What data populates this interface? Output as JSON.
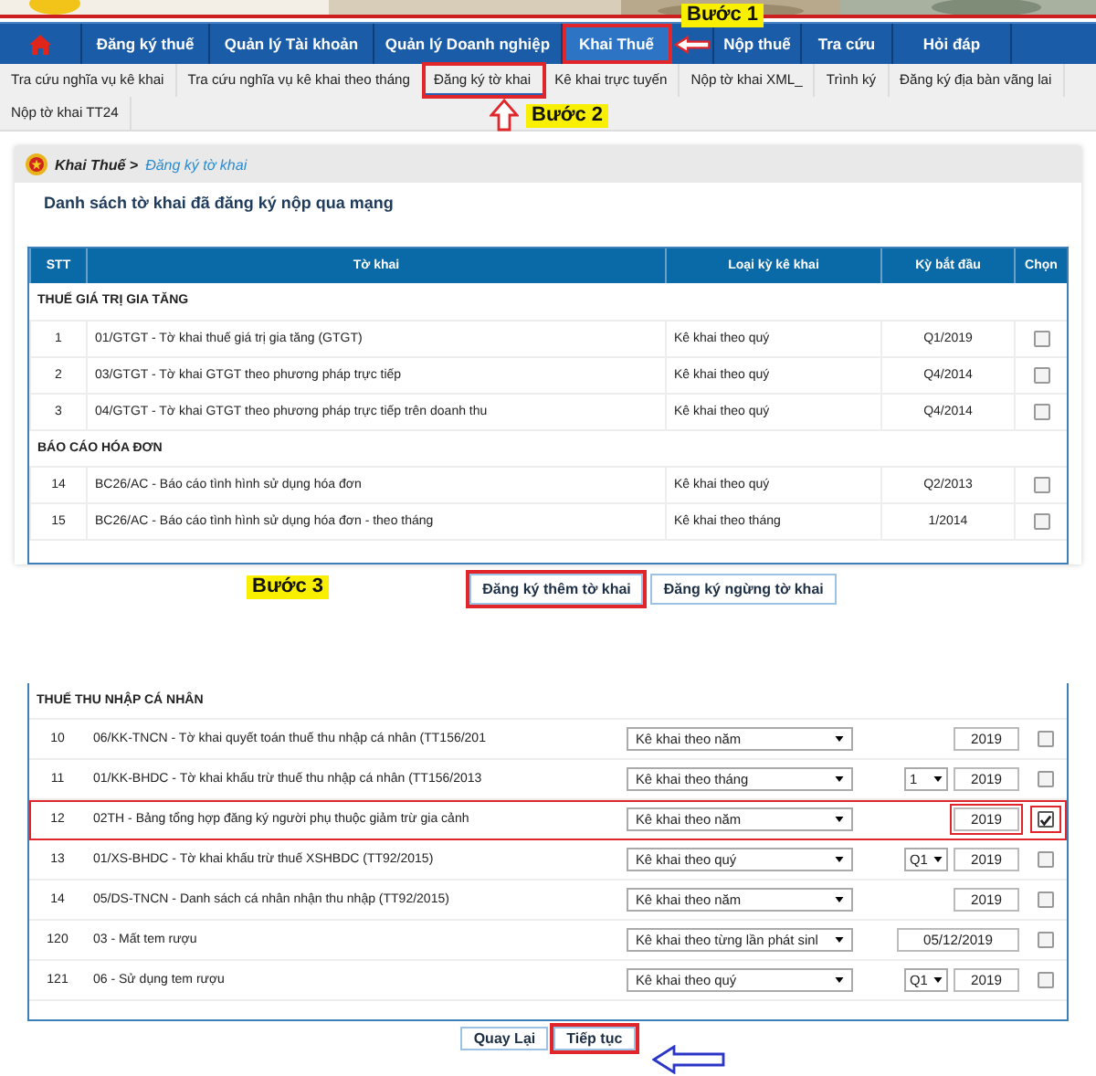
{
  "nav": {
    "items": [
      {
        "kind": "home",
        "selected": false,
        "highlighted": false
      },
      {
        "label": "Đăng ký thuế",
        "selected": false,
        "highlighted": false
      },
      {
        "label": "Quản lý Tài khoản",
        "selected": false,
        "highlighted": false
      },
      {
        "label": "Quản lý Doanh nghiệp",
        "selected": false,
        "highlighted": false
      },
      {
        "label": "Khai Thuế",
        "selected": true,
        "highlighted": true
      },
      {
        "label": "Nộp thuế",
        "selected": false,
        "highlighted": false
      },
      {
        "label": "Tra cứu",
        "selected": false,
        "highlighted": false
      },
      {
        "label": "Hỏi đáp",
        "selected": false,
        "highlighted": false
      }
    ]
  },
  "subnav": {
    "items": [
      {
        "label": "Tra cứu nghĩa vụ kê khai",
        "selected": false,
        "highlighted": false
      },
      {
        "label": "Tra cứu nghĩa vụ kê khai theo tháng",
        "selected": false,
        "highlighted": false
      },
      {
        "label": "Đăng ký tờ khai",
        "selected": true,
        "highlighted": true
      },
      {
        "label": "Kê khai trực tuyến",
        "selected": false,
        "highlighted": false
      },
      {
        "label": "Nộp tờ khai XML_",
        "selected": false,
        "highlighted": false
      },
      {
        "label": "Trình ký",
        "selected": false,
        "highlighted": false
      },
      {
        "label": "Đăng ký địa bàn vãng lai",
        "selected": false,
        "highlighted": false
      },
      {
        "label": "Nộp tờ khai TT24",
        "selected": false,
        "highlighted": false
      }
    ]
  },
  "breadcrumb": {
    "parent": "Khai Thuế >",
    "current": "Đăng ký tờ khai"
  },
  "registered": {
    "title": "Danh sách tờ khai đã đăng ký nộp qua mạng",
    "columns": [
      "STT",
      "Tờ khai",
      "Loại kỳ kê khai",
      "Kỳ bắt đầu",
      "Chọn"
    ],
    "groups": [
      {
        "name": "THUẾ GIÁ TRỊ GIA TĂNG",
        "rows": [
          {
            "stt": "1",
            "form": "01/GTGT - Tờ khai thuế giá trị gia tăng (GTGT)",
            "period": "Kê khai theo quý",
            "start": "Q1/2019",
            "checked": false
          },
          {
            "stt": "2",
            "form": "03/GTGT - Tờ khai GTGT theo phương pháp trực tiếp",
            "period": "Kê khai theo quý",
            "start": "Q4/2014",
            "checked": false
          },
          {
            "stt": "3",
            "form": "04/GTGT - Tờ khai GTGT theo phương pháp trực tiếp trên doanh thu",
            "period": "Kê khai theo quý",
            "start": "Q4/2014",
            "checked": false
          }
        ]
      },
      {
        "name": "BÁO CÁO HÓA ĐƠN",
        "rows": [
          {
            "stt": "14",
            "form": "BC26/AC - Báo cáo tình hình sử dụng hóa đơn",
            "period": "Kê khai theo quý",
            "start": "Q2/2013",
            "checked": false
          },
          {
            "stt": "15",
            "form": "BC26/AC - Báo cáo tình hình sử dụng hóa đơn - theo tháng",
            "period": "Kê khai theo tháng",
            "start": "1/2014",
            "checked": false
          }
        ]
      }
    ],
    "buttons": [
      {
        "label": "Đăng ký thêm tờ khai",
        "highlighted": true
      },
      {
        "label": "Đăng ký ngừng tờ khai",
        "highlighted": false
      }
    ]
  },
  "new_forms": {
    "group": "THUẾ THU NHẬP CÁ NHÂN",
    "rows": [
      {
        "stt": "10",
        "form": "06/KK-TNCN - Tờ khai quyết toán thuế thu nhập cá nhân (TT156/201",
        "period": "Kê khai theo năm",
        "kind": "year",
        "year": "2019",
        "checked": false,
        "highlighted": false
      },
      {
        "stt": "11",
        "form": "01/KK-BHDC - Tờ khai khấu trừ thuế thu nhập cá nhân (TT156/2013",
        "period": "Kê khai theo tháng",
        "kind": "sub-year",
        "sub": "1",
        "year": "2019",
        "checked": false,
        "highlighted": false
      },
      {
        "stt": "12",
        "form": "02TH - Bảng tổng hợp đăng ký người phụ thuộc giảm trừ gia cảnh",
        "period": "Kê khai theo năm",
        "kind": "year",
        "year": "2019",
        "checked": true,
        "highlighted": true
      },
      {
        "stt": "13",
        "form": "01/XS-BHDC - Tờ khai khấu trừ thuế XSHBDC (TT92/2015)",
        "period": "Kê khai theo quý",
        "kind": "sub-year",
        "sub": "Q1",
        "year": "2019",
        "checked": false,
        "highlighted": false
      },
      {
        "stt": "14",
        "form": "05/DS-TNCN - Danh sách cá nhân nhận thu nhập (TT92/2015)",
        "period": "Kê khai theo năm",
        "kind": "year",
        "year": "2019",
        "checked": false,
        "highlighted": false
      },
      {
        "stt": "120",
        "form": "03 - Mất tem rượu",
        "period": "Kê khai theo từng lần phát sinl",
        "kind": "date",
        "date": "05/12/2019",
        "checked": false,
        "highlighted": false
      },
      {
        "stt": "121",
        "form": "06 - Sử dụng tem rượu",
        "period": "Kê khai theo quý",
        "kind": "sub-year",
        "sub": "Q1",
        "year": "2019",
        "checked": false,
        "highlighted": false
      }
    ],
    "buttons": [
      {
        "label": "Quay Lại",
        "highlighted": false
      },
      {
        "label": "Tiếp tục",
        "highlighted": true
      }
    ]
  },
  "annotations": [
    {
      "kind": "step",
      "text": "Bước 1"
    },
    {
      "kind": "step",
      "text": "Bước 2"
    },
    {
      "kind": "step",
      "text": "Bước 3"
    },
    {
      "kind": "arrow-left"
    },
    {
      "kind": "arrow-up"
    },
    {
      "kind": "arrow-left-blue"
    }
  ]
}
